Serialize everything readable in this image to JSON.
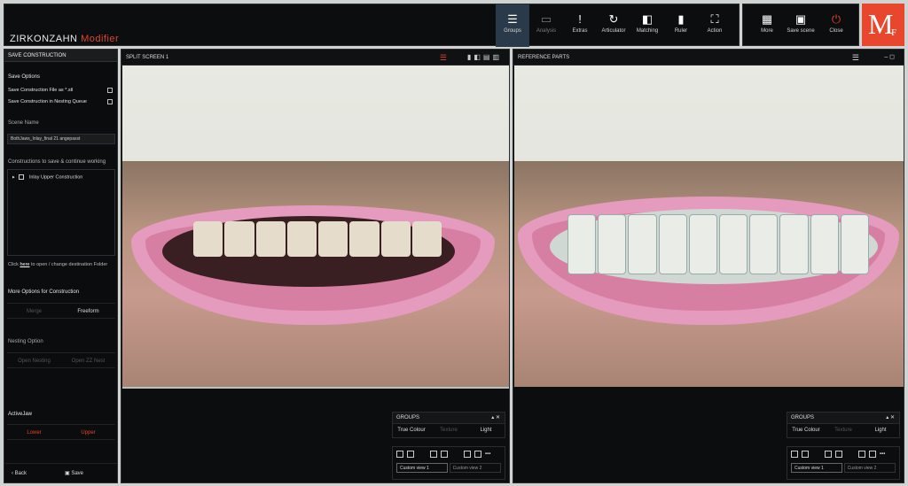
{
  "app": {
    "brand": "ZIRKONZAHN",
    "brand_accent": "Modifier"
  },
  "toolbar": {
    "items": [
      {
        "label": "Groups",
        "icon": "☰",
        "active": true
      },
      {
        "label": "Analysis",
        "icon": "▭",
        "dim": true
      },
      {
        "label": "Extras",
        "icon": "!"
      },
      {
        "label": "Articulator",
        "icon": "↻"
      },
      {
        "label": "Matching",
        "icon": "◧"
      },
      {
        "label": "Ruler",
        "icon": "▮"
      },
      {
        "label": "Action",
        "icon": "⛶"
      }
    ]
  },
  "toolbar2": {
    "items": [
      {
        "label": "More",
        "icon": "▦"
      },
      {
        "label": "Save scene",
        "icon": "▣"
      },
      {
        "label": "Close",
        "icon": "⏻"
      }
    ]
  },
  "logo": {
    "m": "M",
    "f": "F"
  },
  "left": {
    "header": "SAVE CONSTRUCTION",
    "save_options": "Save Options",
    "opt1": "Save Construction File as *.stl",
    "opt2": "Save Construction in Nesting Queue",
    "scene_name_label": "Scene Name",
    "scene_name_value": "BothJaws_Inlay_final 21 angepasst",
    "constructions_label": "Constructions to save & continue working",
    "construction_item": "Inlay Upper Construction",
    "folder_pre": "Click",
    "folder_link": "here",
    "folder_post": "to open / change destination Folder",
    "more_options": "More Options for Construction",
    "merge": "Merge",
    "freeform": "Freeform",
    "nesting_label": "Nesting Option",
    "open_nesting": "Open Nesting",
    "open_zz": "Open ZZ Nest",
    "jaw_label": "ActiveJaw",
    "lower": "Lower",
    "upper": "Upper",
    "back": "Back",
    "save": "Save"
  },
  "split": {
    "title": "SPLIT SCREEN 1"
  },
  "ref": {
    "title": "REFERENCE PARTS"
  },
  "groups": {
    "title": "GROUPS",
    "true_colour": "True Colour",
    "texture": "Texture",
    "light": "Light",
    "view1": "Custom view 1",
    "view2": "Custom view 2"
  },
  "colors": {
    "accent": "#e0452e",
    "logo": "#e8462d"
  }
}
